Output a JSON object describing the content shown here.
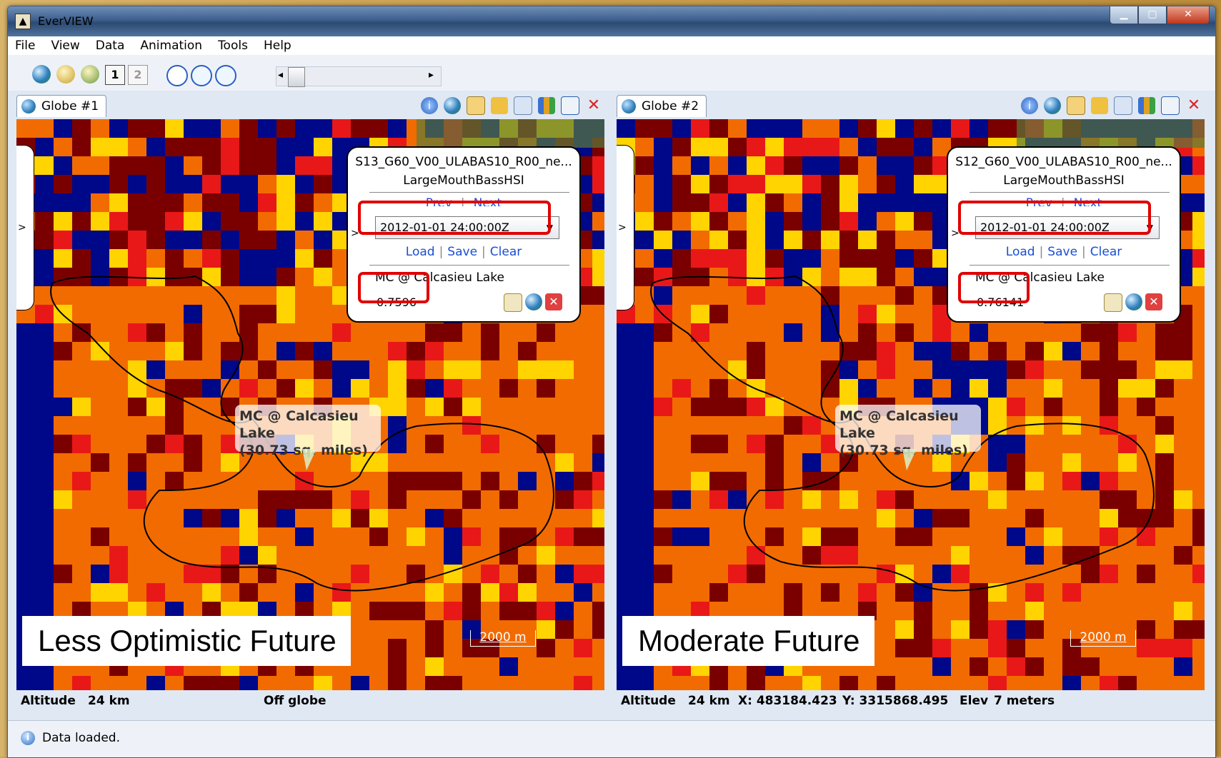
{
  "window": {
    "title": "EverVIEW"
  },
  "menu": [
    "File",
    "View",
    "Data",
    "Animation",
    "Tools",
    "Help"
  ],
  "toolbar": {
    "icons": [
      "globe-add-icon",
      "layer-open-icon",
      "layer-save-icon",
      "single-view-icon",
      "dual-view-icon",
      "stop-icon",
      "play-icon",
      "pause-icon"
    ],
    "slider_left": "◂",
    "slider_right": "▸"
  },
  "panes": [
    {
      "tab": "Globe #1",
      "info": {
        "file": "S13_G60_V00_ULABAS10_R00_ne...",
        "variable": "LargeMouthBassHSI",
        "prev": "Prev",
        "next": "Next",
        "time": "2012-01-01 24:00:00Z",
        "load": "Load",
        "save": "Save",
        "clear": "Clear",
        "location": "MC @ Calcasieu Lake",
        "value": "0.7596"
      },
      "callout": {
        "line1": "MC @ Calcasieu Lake",
        "line2": "(30.73 sq. miles)"
      },
      "caption": "Less Optimistic Future",
      "scale": "2000 m",
      "status": {
        "altitude_label": "Altitude",
        "altitude": "24 km",
        "position": "Off globe"
      }
    },
    {
      "tab": "Globe #2",
      "info": {
        "file": "S12_G60_V00_ULABAS10_R00_ne...",
        "variable": "LargeMouthBassHSI",
        "prev": "Prev",
        "next": "Next",
        "time": "2012-01-01 24:00:00Z",
        "load": "Load",
        "save": "Save",
        "clear": "Clear",
        "location": "MC @ Calcasieu Lake",
        "value": "0.76141"
      },
      "callout": {
        "line1": "MC @ Calcasieu Lake",
        "line2": "(30.73 sq. miles)"
      },
      "caption": "Moderate Future",
      "scale": "2000 m",
      "status": {
        "altitude_label": "Altitude",
        "altitude": "24 km",
        "x": "X: 483184.423",
        "y": "Y: 3315868.495",
        "elev_label": "Elev",
        "elev": "7 meters"
      }
    }
  ],
  "statusbar": {
    "message": "Data loaded."
  },
  "colors": {
    "red_highlight": "#e00000",
    "hsi_low": "#7a0000",
    "hsi_mid": "#f26b00",
    "hsi_high": "#ffd400",
    "water": "#00088a"
  }
}
